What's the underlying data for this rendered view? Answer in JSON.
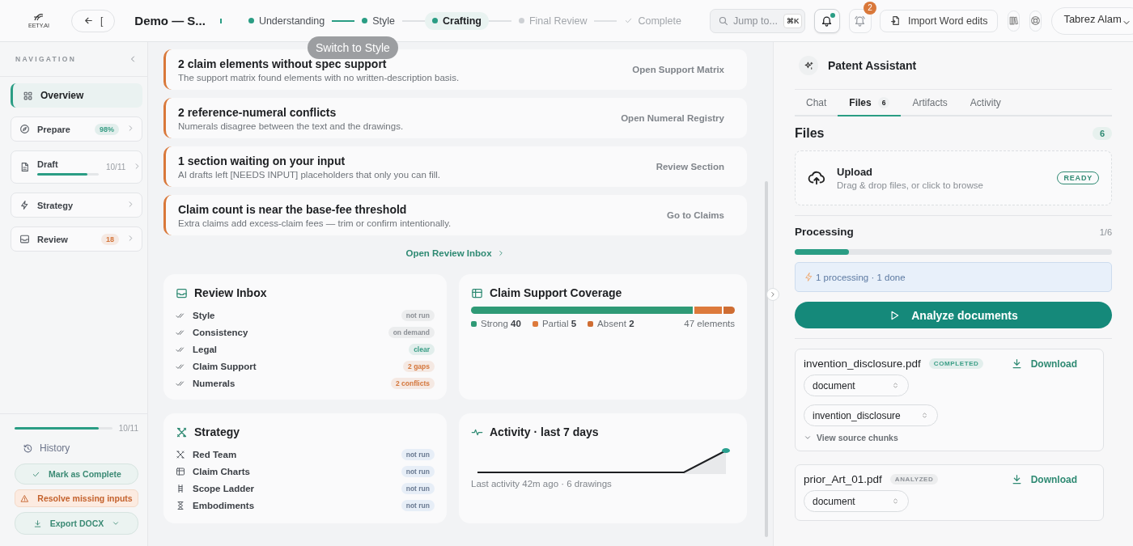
{
  "header": {
    "logo_text": "EETY.AI",
    "back_text": "[",
    "document_title": "Demo — S...",
    "steps": [
      {
        "label": "Understanding",
        "done": true,
        "selected": false,
        "kind": "dot"
      },
      {
        "label": "Style",
        "done": true,
        "selected": false,
        "kind": "dot"
      },
      {
        "label": "Crafting",
        "done": true,
        "selected": true,
        "kind": "dot"
      },
      {
        "label": "Final Review",
        "done": false,
        "selected": false,
        "kind": "dot"
      },
      {
        "label": "Complete",
        "done": false,
        "selected": false,
        "kind": "check"
      }
    ],
    "search": {
      "placeholder": "Jump to...",
      "shortcut": "⌘K"
    },
    "notifications": [
      {
        "kind": "bell",
        "unread": true
      },
      {
        "kind": "bell-ring",
        "count": "2"
      }
    ],
    "import_button": "Import Word edits",
    "user": {
      "name": "Tabrez Alam"
    },
    "tooltip": "Switch to Style"
  },
  "sidebar": {
    "heading": "NAVIGATION",
    "items": [
      {
        "label": "Overview",
        "kind": "grid",
        "selected": true
      },
      {
        "label": "Prepare",
        "kind": "compass",
        "selected": false,
        "badge": "98%",
        "color": "#3a9e86"
      },
      {
        "label": "Draft",
        "kind": "doc",
        "selected": false,
        "reading": "10/11",
        "level": 0.82
      },
      {
        "label": "Strategy",
        "kind": "bolt",
        "selected": false
      },
      {
        "label": "Review",
        "kind": "inbox",
        "selected": false,
        "badge": "18",
        "color": "#d4763b"
      }
    ],
    "progress": {
      "level": 0.86,
      "reading": "10/11"
    },
    "history": "History",
    "actions": [
      {
        "label": "Mark as Complete",
        "kind": "complete"
      },
      {
        "label": "Resolve missing inputs",
        "kind": "warning"
      },
      {
        "label": "Export DOCX",
        "kind": "export"
      }
    ]
  },
  "alerts": [
    {
      "title": "2 claim elements without spec support",
      "description": "The support matrix found elements with no written-description basis.",
      "action": "Open Support Matrix"
    },
    {
      "title": "2 reference-numeral conflicts",
      "description": "Numerals disagree between the text and the drawings.",
      "action": "Open Numeral Registry"
    },
    {
      "title": "1 section waiting on your input",
      "description": "AI drafts left [NEEDS INPUT] placeholders that only you can fill.",
      "action": "Review Section"
    },
    {
      "title": "Claim count is near the base-fee threshold",
      "description": "Extra claims add excess-claim fees — trim or confirm intentionally.",
      "action": "Go to Claims"
    }
  ],
  "review_inbox_link": "Open Review Inbox",
  "review_inbox": {
    "title": "Review Inbox",
    "items": [
      {
        "label": "Style",
        "status": "not run",
        "color": "#8d9197"
      },
      {
        "label": "Consistency",
        "status": "on demand",
        "color": "#8d9197"
      },
      {
        "label": "Legal",
        "status": "clear",
        "color": "#3a9e86"
      },
      {
        "label": "Claim Support",
        "status": "2 gaps",
        "color": "#d4763b"
      },
      {
        "label": "Numerals",
        "status": "2 conflicts",
        "color": "#d4763b"
      }
    ]
  },
  "coverage": {
    "title": "Claim Support Coverage",
    "segments": [
      {
        "label": "Strong",
        "count": "40",
        "color": "#2f9a76"
      },
      {
        "label": "Partial",
        "count": "5",
        "color": "#dd7a3c"
      },
      {
        "label": "Absent",
        "count": "2",
        "color": "#cf6d33"
      }
    ],
    "total": "47 elements"
  },
  "strategy": {
    "title": "Strategy",
    "items": [
      {
        "label": "Red Team",
        "status": "not run",
        "kind": "tools"
      },
      {
        "label": "Claim Charts",
        "status": "not run",
        "kind": "table"
      },
      {
        "label": "Scope Ladder",
        "status": "not run",
        "kind": "ladder"
      },
      {
        "label": "Embodiments",
        "status": "not run",
        "kind": "hourglass"
      }
    ]
  },
  "activity": {
    "title": "Activity · last 7 days",
    "caption": "Last activity 42m ago · 6 drawings"
  },
  "assistant": {
    "title": "Patent Assistant",
    "tabs": [
      {
        "label": "Chat",
        "selected": false
      },
      {
        "label": "Files",
        "count": "6",
        "selected": true
      },
      {
        "label": "Artifacts",
        "selected": false
      },
      {
        "label": "Activity",
        "selected": false
      }
    ],
    "files_heading": "Files",
    "files_count": "6",
    "upload": {
      "title": "Upload",
      "hint": "Drag & drop files, or click to browse",
      "status": "READY"
    },
    "processing": {
      "title": "Processing",
      "reading": "1/6",
      "level": 0.17,
      "info": "1 processing · 1 done"
    },
    "analyze_button": "Analyze documents",
    "files": [
      {
        "name": "invention_disclosure.pdf",
        "status": "COMPLETED",
        "color": "#3a9e86",
        "download": "Download",
        "selects": [
          "document",
          "invention_disclosure"
        ],
        "chunks_link": "View source chunks"
      },
      {
        "name": "prior_Art_01.pdf",
        "status": "ANALYZED",
        "color": "#8d9197",
        "download": "Download",
        "selects": [
          "document"
        ]
      }
    ]
  }
}
